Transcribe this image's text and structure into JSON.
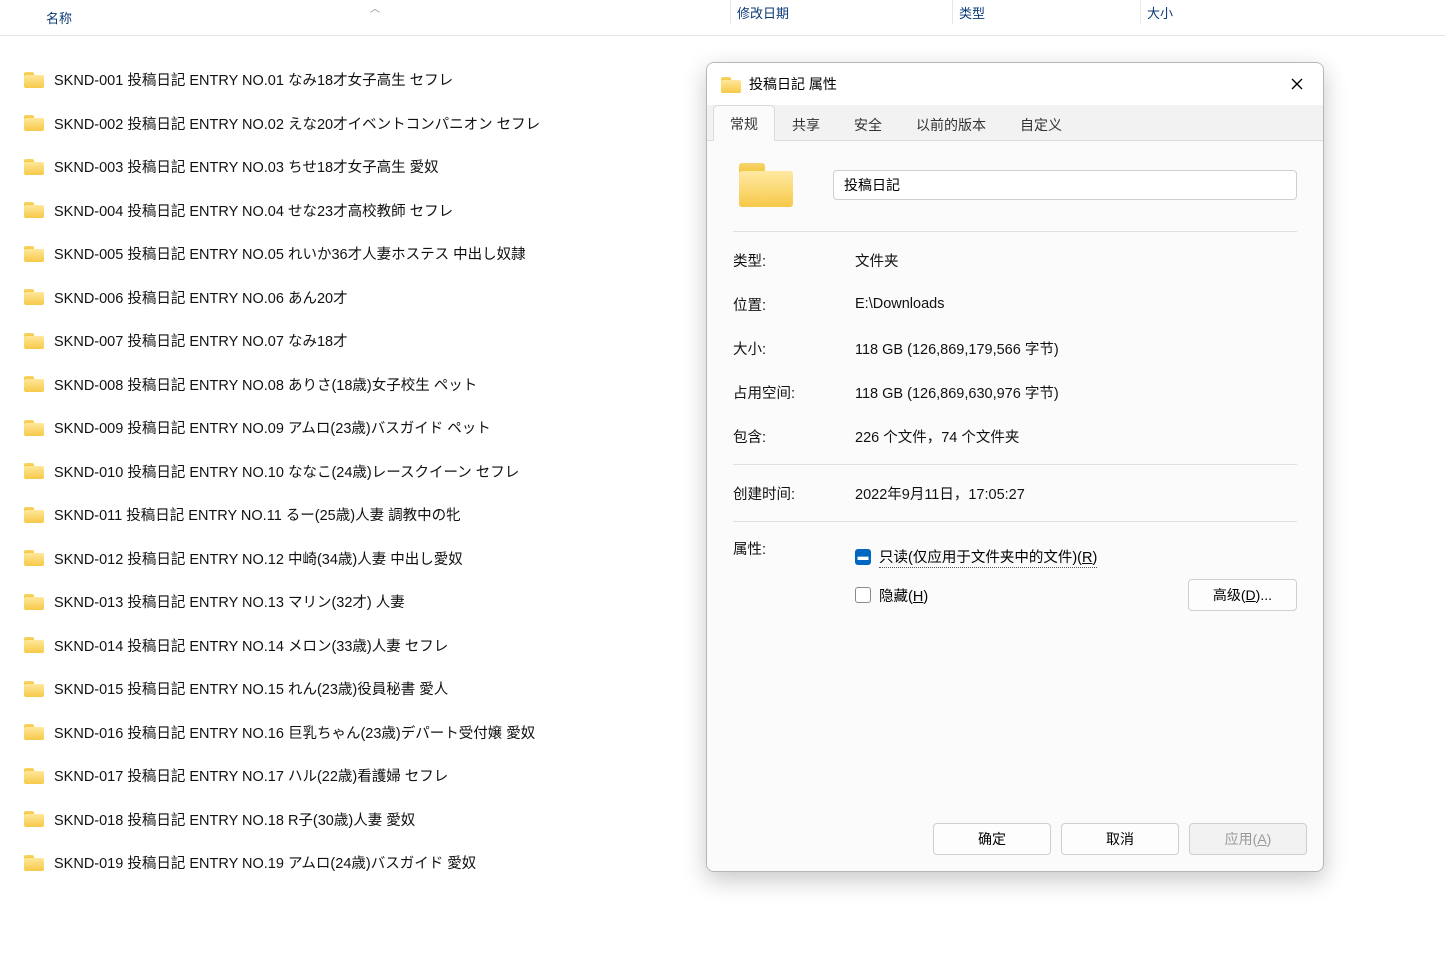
{
  "columns": {
    "name": "名称",
    "date": "修改日期",
    "type": "类型",
    "size": "大小"
  },
  "files": [
    {
      "name": "SKND-001 投稿日記 ENTRY NO.01 なみ18才女子高生 セフレ"
    },
    {
      "name": "SKND-002 投稿日記 ENTRY NO.02 えな20才イベントコンパニオン セフレ"
    },
    {
      "name": "SKND-003 投稿日記 ENTRY NO.03 ちせ18才女子高生 愛奴"
    },
    {
      "name": "SKND-004 投稿日記 ENTRY NO.04 せな23才高校教師 セフレ"
    },
    {
      "name": "SKND-005 投稿日記 ENTRY NO.05 れいか36才人妻ホステス 中出し奴隷"
    },
    {
      "name": "SKND-006 投稿日記 ENTRY NO.06 あん20才"
    },
    {
      "name": "SKND-007 投稿日記 ENTRY NO.07 なみ18才"
    },
    {
      "name": "SKND-008 投稿日記 ENTRY NO.08 ありさ(18歳)女子校生 ペット"
    },
    {
      "name": "SKND-009 投稿日記 ENTRY NO.09 アムロ(23歳)バスガイド ペット"
    },
    {
      "name": "SKND-010 投稿日記 ENTRY NO.10 ななこ(24歳)レースクイーン セフレ"
    },
    {
      "name": "SKND-011 投稿日記 ENTRY NO.11 るー(25歳)人妻 調教中の牝"
    },
    {
      "name": "SKND-012 投稿日記 ENTRY NO.12 中崎(34歳)人妻 中出し愛奴"
    },
    {
      "name": "SKND-013 投稿日記 ENTRY NO.13 マリン(32才) 人妻"
    },
    {
      "name": "SKND-014 投稿日記 ENTRY NO.14 メロン(33歳)人妻 セフレ"
    },
    {
      "name": "SKND-015 投稿日記 ENTRY NO.15 れん(23歳)役員秘書 愛人"
    },
    {
      "name": "SKND-016 投稿日記 ENTRY NO.16 巨乳ちゃん(23歳)デパート受付嬢 愛奴"
    },
    {
      "name": "SKND-017 投稿日記 ENTRY NO.17 ハル(22歳)看護婦 セフレ"
    },
    {
      "name": "SKND-018 投稿日記 ENTRY NO.18 R子(30歳)人妻 愛奴"
    },
    {
      "name": "SKND-019 投稿日記 ENTRY NO.19 アムロ(24歳)バスガイド 愛奴"
    }
  ],
  "dialog": {
    "title": "投稿日記 属性",
    "tabs": {
      "general": "常规",
      "share": "共享",
      "security": "安全",
      "previous": "以前的版本",
      "custom": "自定义"
    },
    "folder_name": "投稿日記",
    "rows": {
      "type_label": "类型:",
      "type_value": "文件夹",
      "location_label": "位置:",
      "location_value": "E:\\Downloads",
      "size_label": "大小:",
      "size_value": "118 GB (126,869,179,566 字节)",
      "disk_label": "占用空间:",
      "disk_value": "118 GB (126,869,630,976 字节)",
      "contains_label": "包含:",
      "contains_value": "226 个文件，74 个文件夹",
      "created_label": "创建时间:",
      "created_value": "2022年9月11日，17:05:27",
      "attr_label": "属性:"
    },
    "attrs": {
      "readonly_prefix": "只读(仅应用于文件夹中的文件)(",
      "readonly_hotkey": "R",
      "readonly_suffix": ")",
      "hidden_prefix": "隐藏(",
      "hidden_hotkey": "H",
      "hidden_suffix": ")",
      "advanced_prefix": "高级(",
      "advanced_hotkey": "D",
      "advanced_suffix": ")..."
    },
    "buttons": {
      "ok": "确定",
      "cancel": "取消",
      "apply_prefix": "应用(",
      "apply_hotkey": "A",
      "apply_suffix": ")"
    }
  }
}
